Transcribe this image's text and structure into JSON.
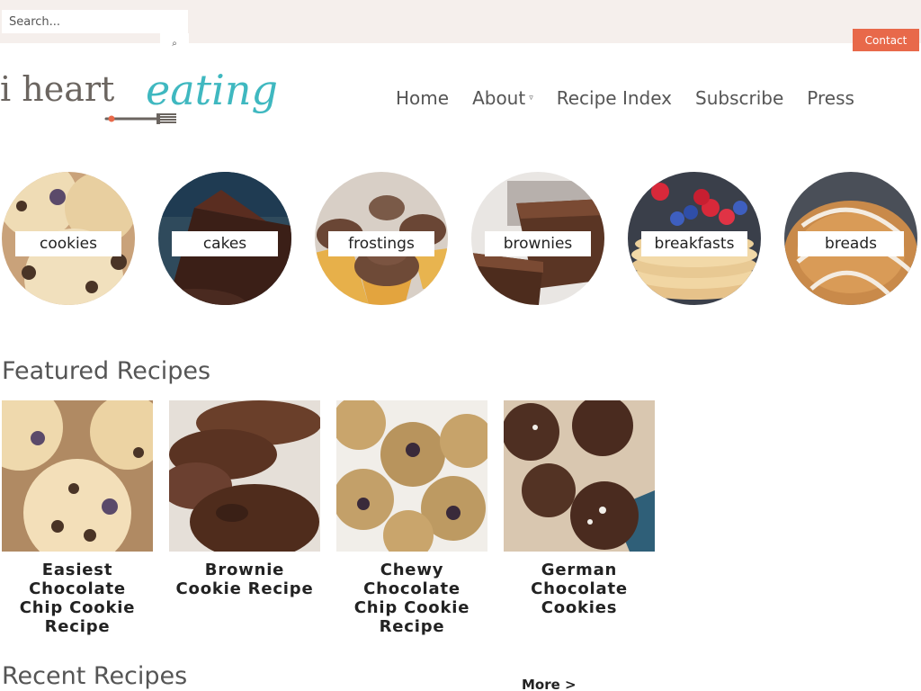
{
  "header": {
    "search_placeholder": "Search...",
    "search_button_label": "⌕",
    "contact_label": "Contact",
    "logo_text": "i heart eating"
  },
  "nav": {
    "items": [
      {
        "label": "Home"
      },
      {
        "label": "About",
        "has_dropdown": true,
        "dropdown_glyph": "⌄"
      },
      {
        "label": "Recipe Index"
      },
      {
        "label": "Subscribe"
      },
      {
        "label": "Press"
      }
    ]
  },
  "categories": [
    {
      "label": "cookies"
    },
    {
      "label": "cakes"
    },
    {
      "label": "frostings"
    },
    {
      "label": "brownies"
    },
    {
      "label": "breakfasts"
    },
    {
      "label": "breads"
    }
  ],
  "featured": {
    "title": "Featured Recipes",
    "recipes": [
      {
        "title": "Easiest Chocolate Chip Cookie Recipe"
      },
      {
        "title": "Brownie Cookie Recipe"
      },
      {
        "title": "Chewy Chocolate Chip Cookie Recipe"
      },
      {
        "title": "German Chocolate Cookies"
      }
    ]
  },
  "recent": {
    "title": "Recent Recipes",
    "more_label": "More >"
  },
  "colors": {
    "topbar_bg": "#f5efec",
    "accent": "#e8694a",
    "logo_teal": "#3fb8c0",
    "logo_gray": "#6b6560"
  }
}
